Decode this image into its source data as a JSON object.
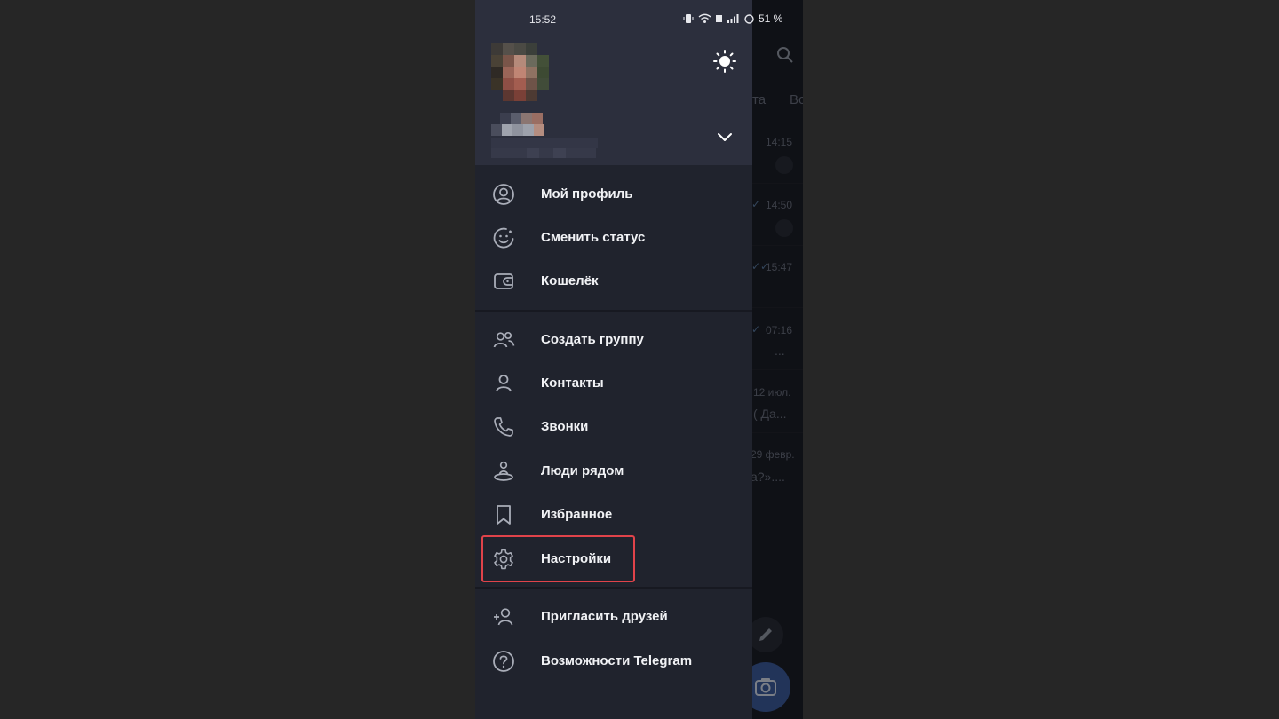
{
  "status_bar": {
    "time": "15:52",
    "battery": "51 %"
  },
  "background_chat": {
    "tabs": [
      "та",
      "Вс"
    ],
    "rows": [
      {
        "time": "14:15",
        "snippet": "",
        "pinned": true,
        "ticks": ""
      },
      {
        "time": "14:50",
        "snippet": "",
        "pinned": true,
        "ticks": "✓"
      },
      {
        "time": "15:47",
        "snippet": "",
        "pinned": false,
        "ticks": "✓✓"
      },
      {
        "time": "07:16",
        "snippet": "—...",
        "pinned": false,
        "ticks": "✓"
      },
      {
        "time": "12 июл.",
        "snippet": "( Да...",
        "pinned": false,
        "ticks": ""
      },
      {
        "time": "29 февр.",
        "snippet": "а?»....",
        "pinned": false,
        "ticks": ""
      }
    ]
  },
  "drawer": {
    "theme_icon": "sun-icon",
    "expand_icon": "chevron-down-icon",
    "menu": [
      {
        "label": "Мой профиль",
        "icon": "profile-circle-icon"
      },
      {
        "label": "Сменить статус",
        "icon": "smile-status-icon"
      },
      {
        "label": "Кошелёк",
        "icon": "wallet-icon"
      },
      {
        "label": "Создать группу",
        "icon": "group-icon"
      },
      {
        "label": "Контакты",
        "icon": "contact-icon"
      },
      {
        "label": "Звонки",
        "icon": "phone-icon"
      },
      {
        "label": "Люди рядом",
        "icon": "people-nearby-icon"
      },
      {
        "label": "Избранное",
        "icon": "bookmark-icon"
      },
      {
        "label": "Настройки",
        "icon": "gear-icon"
      },
      {
        "label": "Пригласить друзей",
        "icon": "add-user-icon"
      },
      {
        "label": "Возможности Telegram",
        "icon": "question-icon"
      }
    ],
    "highlighted_item": "Настройки"
  },
  "colors": {
    "drawer_bg": "#20232d",
    "header_bg": "#2c2f3d",
    "text": "#f1f2f5",
    "icon": "#a9adb8",
    "highlight": "#e0434a"
  }
}
